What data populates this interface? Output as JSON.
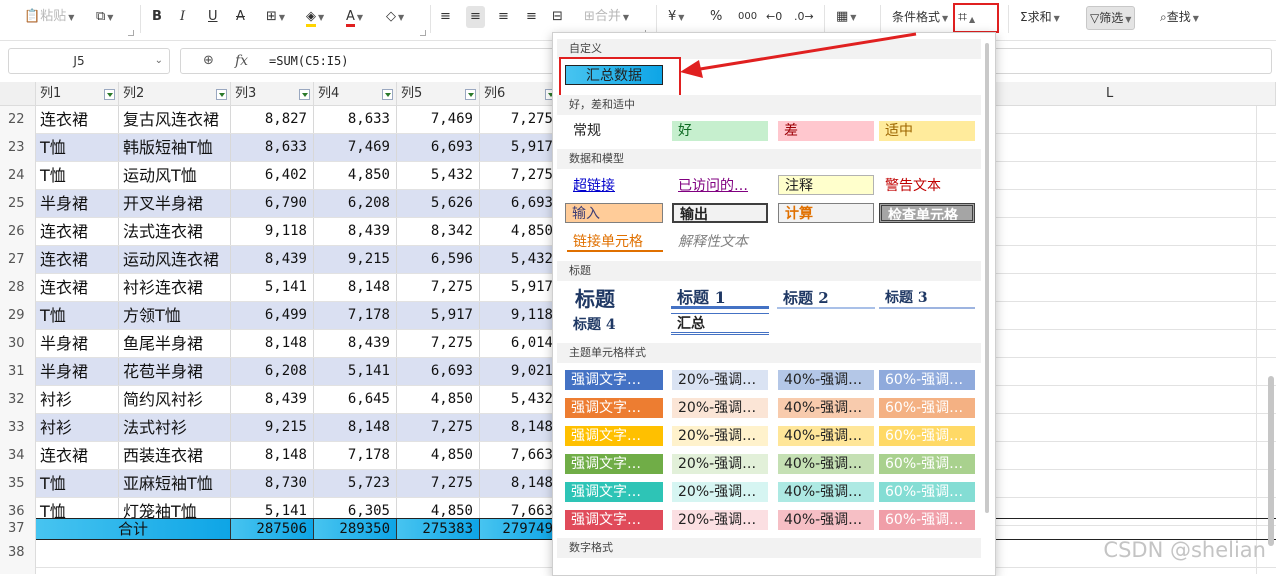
{
  "toolbar": {
    "paste": "粘贴",
    "merge": "合并",
    "currency": "¥",
    "percent": "%",
    "cond_format": "条件格式",
    "sum": "求和",
    "filter": "筛选",
    "find": "查找"
  },
  "formula_bar": {
    "cell_ref": "J5",
    "formula": "=SUM(C5:I5)"
  },
  "columns": [
    {
      "label": "列1"
    },
    {
      "label": "列2"
    },
    {
      "label": "列3"
    },
    {
      "label": "列4"
    },
    {
      "label": "列5"
    },
    {
      "label": "列6"
    }
  ],
  "right_col_label": "L",
  "rows": [
    {
      "num": "22",
      "c1": "连衣裙",
      "c2": "复古风连衣裙",
      "c3": "8,827",
      "c4": "8,633",
      "c5": "7,469",
      "c6": "7,275"
    },
    {
      "num": "23",
      "c1": "T恤",
      "c2": "韩版短袖T恤",
      "c3": "8,633",
      "c4": "7,469",
      "c5": "6,693",
      "c6": "5,917"
    },
    {
      "num": "24",
      "c1": "T恤",
      "c2": "运动风T恤",
      "c3": "6,402",
      "c4": "4,850",
      "c5": "5,432",
      "c6": "7,275"
    },
    {
      "num": "25",
      "c1": "半身裙",
      "c2": "开叉半身裙",
      "c3": "6,790",
      "c4": "6,208",
      "c5": "5,626",
      "c6": "6,693"
    },
    {
      "num": "26",
      "c1": "连衣裙",
      "c2": "法式连衣裙",
      "c3": "9,118",
      "c4": "8,439",
      "c5": "8,342",
      "c6": "4,850"
    },
    {
      "num": "27",
      "c1": "连衣裙",
      "c2": "运动风连衣裙",
      "c3": "8,439",
      "c4": "9,215",
      "c5": "6,596",
      "c6": "5,432"
    },
    {
      "num": "28",
      "c1": "连衣裙",
      "c2": "衬衫连衣裙",
      "c3": "5,141",
      "c4": "8,148",
      "c5": "7,275",
      "c6": "5,917"
    },
    {
      "num": "29",
      "c1": "T恤",
      "c2": "方领T恤",
      "c3": "6,499",
      "c4": "7,178",
      "c5": "5,917",
      "c6": "9,118"
    },
    {
      "num": "30",
      "c1": "半身裙",
      "c2": "鱼尾半身裙",
      "c3": "8,148",
      "c4": "8,439",
      "c5": "7,275",
      "c6": "6,014"
    },
    {
      "num": "31",
      "c1": "半身裙",
      "c2": "花苞半身裙",
      "c3": "6,208",
      "c4": "5,141",
      "c5": "6,693",
      "c6": "9,021"
    },
    {
      "num": "32",
      "c1": "衬衫",
      "c2": "简约风衬衫",
      "c3": "8,439",
      "c4": "6,645",
      "c5": "4,850",
      "c6": "5,432"
    },
    {
      "num": "33",
      "c1": "衬衫",
      "c2": "法式衬衫",
      "c3": "9,215",
      "c4": "8,148",
      "c5": "7,275",
      "c6": "8,148"
    },
    {
      "num": "34",
      "c1": "连衣裙",
      "c2": "西装连衣裙",
      "c3": "8,148",
      "c4": "7,178",
      "c5": "4,850",
      "c6": "7,663"
    },
    {
      "num": "35",
      "c1": "T恤",
      "c2": "亚麻短袖T恤",
      "c3": "8,730",
      "c4": "5,723",
      "c5": "7,275",
      "c6": "8,148"
    },
    {
      "num": "36",
      "c1": "T恤",
      "c2": "灯笼袖T恤",
      "c3": "5,141",
      "c4": "6,305",
      "c5": "4,850",
      "c6": "7,663"
    }
  ],
  "total_row": {
    "num": "37",
    "label": "合计",
    "c3": "287506",
    "c4": "289350",
    "c5": "275383",
    "c6": "279749"
  },
  "blank_row": {
    "num": "38"
  },
  "panel": {
    "custom_title": "自定义",
    "custom_item": "汇总数据",
    "good_bad_title": "好，差和适中",
    "normal": "常规",
    "good": "好",
    "bad": "差",
    "neutral": "适中",
    "data_model_title": "数据和模型",
    "hyperlink": "超链接",
    "visited": "已访问的…",
    "note": "注释",
    "warning": "警告文本",
    "input": "输入",
    "output": "输出",
    "calc": "计算",
    "check_cell": "检查单元格",
    "linked_cell": "链接单元格",
    "explanatory": "解释性文本",
    "titles_title": "标题",
    "title": "标题",
    "heading1": "标题 1",
    "heading2": "标题 2",
    "heading3": "标题 3",
    "heading4": "标题 4",
    "total": "汇总",
    "theme_title": "主题单元格样式",
    "accent": "强调文字…",
    "p20": "20%-强调…",
    "p40": "40%-强调…",
    "p60": "60%-强调…",
    "number_format_title": "数字格式"
  },
  "theme_colors": [
    {
      "accent": "#4472c4",
      "p20": "#dae3f3",
      "p40": "#b4c7e7",
      "p60": "#8faadc"
    },
    {
      "accent": "#ed7d31",
      "p20": "#fbe5d6",
      "p40": "#f8cbad",
      "p60": "#f4b183"
    },
    {
      "accent": "#ffc000",
      "p20": "#fff2cc",
      "p40": "#ffe699",
      "p60": "#ffd966"
    },
    {
      "accent": "#70ad47",
      "p20": "#e2f0d9",
      "p40": "#c5e0b4",
      "p60": "#a9d18e"
    },
    {
      "accent": "#2ec4b6",
      "p20": "#d6f5f2",
      "p40": "#ade9e3",
      "p60": "#84ddd4"
    },
    {
      "accent": "#e04b5a",
      "p20": "#fbdfe2",
      "p40": "#f6bfc5",
      "p60": "#f09ea8"
    }
  ],
  "watermark": "CSDN @shelian"
}
